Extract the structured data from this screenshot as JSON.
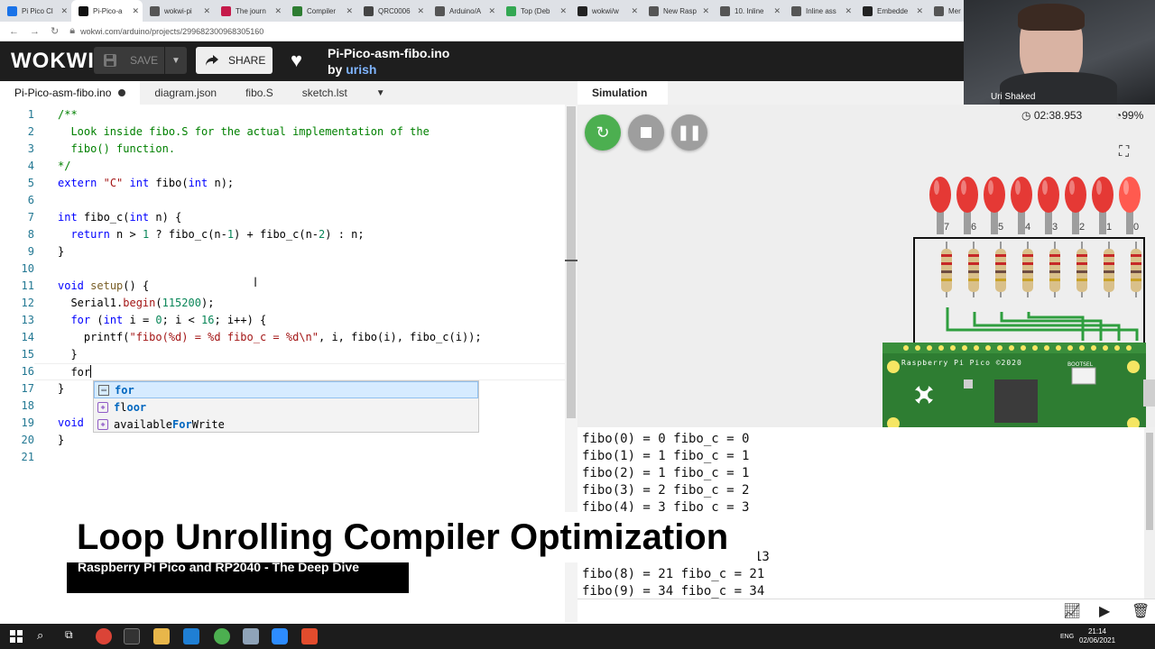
{
  "browser": {
    "tabs": [
      {
        "title": "Pi Pico Cl",
        "color": "#1a73e8"
      },
      {
        "title": "Pi-Pico-a",
        "color": "#111111"
      },
      {
        "title": "wokwi-pi",
        "color": "#555555"
      },
      {
        "title": "The journ",
        "color": "#c51a4a"
      },
      {
        "title": "Compiler",
        "color": "#2e7d32"
      },
      {
        "title": "QRC0006",
        "color": "#444444"
      },
      {
        "title": "Arduino/A",
        "color": "#555555"
      },
      {
        "title": "Top (Deb",
        "color": "#34a853"
      },
      {
        "title": "wokwi/w",
        "color": "#222222"
      },
      {
        "title": "New Rasp",
        "color": "#555555"
      },
      {
        "title": "10. Inline",
        "color": "#555555"
      },
      {
        "title": "Inline ass",
        "color": "#555555"
      },
      {
        "title": "Embedde",
        "color": "#222222"
      },
      {
        "title": "Mer",
        "color": "#555555"
      }
    ],
    "url": "wokwi.com/arduino/projects/299682300968305160"
  },
  "header": {
    "logo": "WOKWI",
    "save_label": "SAVE",
    "share_label": "SHARE",
    "project_title": "Pi-Pico-asm-fibo.ino",
    "by_label": "by",
    "author": "urish"
  },
  "webcam": {
    "name": "Uri Shaked"
  },
  "editor": {
    "tabs": [
      "Pi-Pico-asm-fibo.ino",
      "diagram.json",
      "fibo.S",
      "sketch.lst"
    ],
    "line_numbers": [
      "1",
      "2",
      "3",
      "4",
      "5",
      "6",
      "7",
      "8",
      "9",
      "10",
      "11",
      "12",
      "13",
      "14",
      "15",
      "16",
      "17",
      "18",
      "19",
      "20",
      "21"
    ],
    "lines": {
      "l1": "/**",
      "l2": "  Look inside fibo.S for the actual implementation of the",
      "l3": "  fibo() function.",
      "l4": "*/",
      "l5_kw": "extern",
      "l5_str": "\"C\"",
      "l5_kw2": "int",
      "l5_rest": " fibo(",
      "l5_kw3": "int",
      "l5_end": " n);",
      "l7_kw": "int",
      "l7_rest": " fibo_c(",
      "l7_kw2": "int",
      "l7_end": " n) {",
      "l8_kw": "return",
      "l8_a": " n > ",
      "l8_n1": "1",
      "l8_b": " ? fibo_c(n-",
      "l8_n2": "1",
      "l8_c": ") + fibo_c(n-",
      "l8_n3": "2",
      "l8_d": ") : n;",
      "l9": "}",
      "l11_kw": "void",
      "l11_fn": "setup",
      "l11_rest": "() {",
      "l12_a": "Serial1.",
      "l12_fn": "begin",
      "l12_b": "(",
      "l12_num": "115200",
      "l12_c": ");",
      "l13_kw": "for",
      "l13_a": " (",
      "l13_kw2": "int",
      "l13_b": " i = ",
      "l13_n1": "0",
      "l13_c": "; i < ",
      "l13_n2": "16",
      "l13_d": "; i++) {",
      "l14_a": "printf(",
      "l14_str": "\"fibo(%d) = %d fibo_c = %d\\n\"",
      "l14_b": ", i, fibo(i), fibo_c(i));",
      "l15": "}",
      "l16": "for",
      "l17": "}",
      "l19": "void",
      "l20": "}"
    }
  },
  "autocomplete": {
    "items": [
      {
        "match": "for",
        "rest": ""
      },
      {
        "match": "f",
        "rest": "l",
        "match2": "o",
        "rest2": "",
        "tail": "or"
      },
      {
        "pre": "available",
        "match": "For",
        "rest": "Write"
      }
    ],
    "i1_match": "for",
    "i2_a": "f",
    "i2_b": "l",
    "i2_c": "oor",
    "i3_a": "available",
    "i3_b": "For",
    "i3_c": "Write"
  },
  "simulation": {
    "tab": "Simulation",
    "timer": "02:38.953",
    "cpu": "99%",
    "board_label": "Raspberry Pi Pico ©2020",
    "bootsel_label": "BOOTSEL",
    "led_labels": [
      "7",
      "6",
      "5",
      "4",
      "3",
      "2",
      "1",
      "0"
    ]
  },
  "serial": {
    "lines": [
      "fibo(0) = 0 fibo_c = 0",
      "fibo(1) = 1 fibo_c = 1",
      "fibo(2) = 1 fibo_c = 1",
      "fibo(3) = 2 fibo_c = 2",
      "fibo(4) = 3 fibo_c = 3",
      "13",
      "fibo(8) = 21 fibo_c = 21",
      "fibo(9) = 34 fibo_c = 34"
    ]
  },
  "overlay": {
    "title": "Loop Unrolling Compiler Optimization",
    "subtitle": "Raspberry Pi Pico and RP2040 - The Deep Dive"
  },
  "taskbar": {
    "time": "21:14",
    "date": "02/06/2021",
    "lang": "ENG"
  },
  "colors": {
    "green_button": "#4caf50",
    "grey_button": "#9e9e9e",
    "led_red": "#e53935",
    "pcb_green": "#2e7d32"
  }
}
